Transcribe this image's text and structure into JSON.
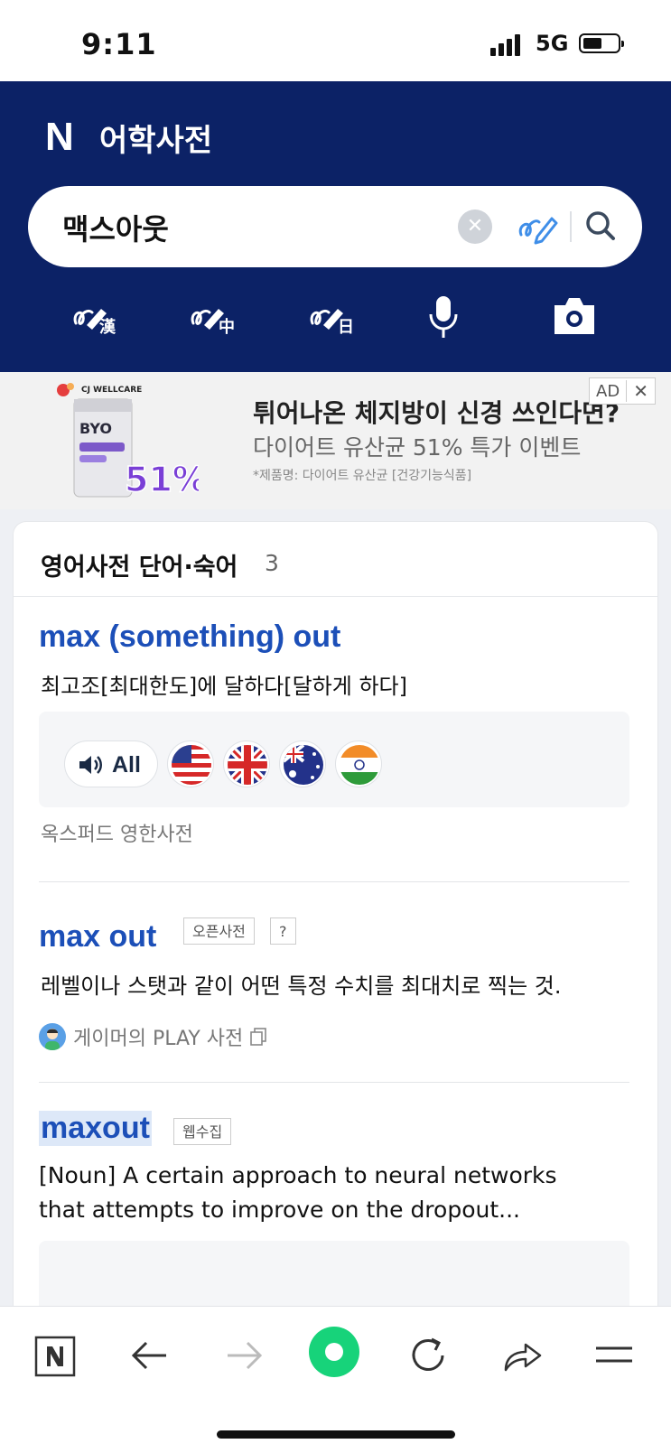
{
  "status_bar": {
    "time": "9:11",
    "network": "5G"
  },
  "header": {
    "logo": "N",
    "title": "어학사전",
    "search": {
      "value": "맥스아웃",
      "placeholder": ""
    },
    "tools": [
      "handwriting-hanja",
      "handwriting-chinese",
      "handwriting-japanese",
      "voice-search",
      "camera-search"
    ]
  },
  "ad": {
    "brand": "CJ WELLCARE",
    "product_label": "BYO",
    "discount": "51%",
    "headline": "튀어나온 체지방이 신경 쓰인다면?",
    "subline": "다이어트 유산균 51% 특가 이벤트",
    "note": "*제품명: 다이어트 유산균 [건강기능식품]",
    "badge": "AD",
    "close": "✕"
  },
  "card": {
    "title": "영어사전 단어·숙어",
    "count": "3",
    "entries": [
      {
        "word": "max (something) out",
        "definition": "최고조[최대한도]에 달하다[달하게 하다]",
        "all_label": "All",
        "flags": [
          "us-flag",
          "uk-flag",
          "au-flag",
          "in-flag"
        ],
        "source": "옥스퍼드 영한사전"
      },
      {
        "word": "max out",
        "tag1": "오픈사전",
        "tag2": "?",
        "definition": "레벨이나 스탯과 같이 어떤 특정 수치를 최대치로 찍는 것.",
        "author": "게이머의 PLAY 사전"
      },
      {
        "word": "maxout",
        "tag": "웹수집",
        "definition_line1": "[Noun] A certain approach to neural networks",
        "definition_line2": "that attempts to improve on the dropout..."
      }
    ]
  },
  "toolbar": {
    "items": [
      "naver-home-icon",
      "back-arrow-icon",
      "forward-arrow-icon",
      "green-dot-icon",
      "reload-icon",
      "share-icon",
      "menu-icon"
    ]
  },
  "colors": {
    "header": "#0c2266",
    "word": "#1c4fb8",
    "accent_green": "#17d37a"
  }
}
